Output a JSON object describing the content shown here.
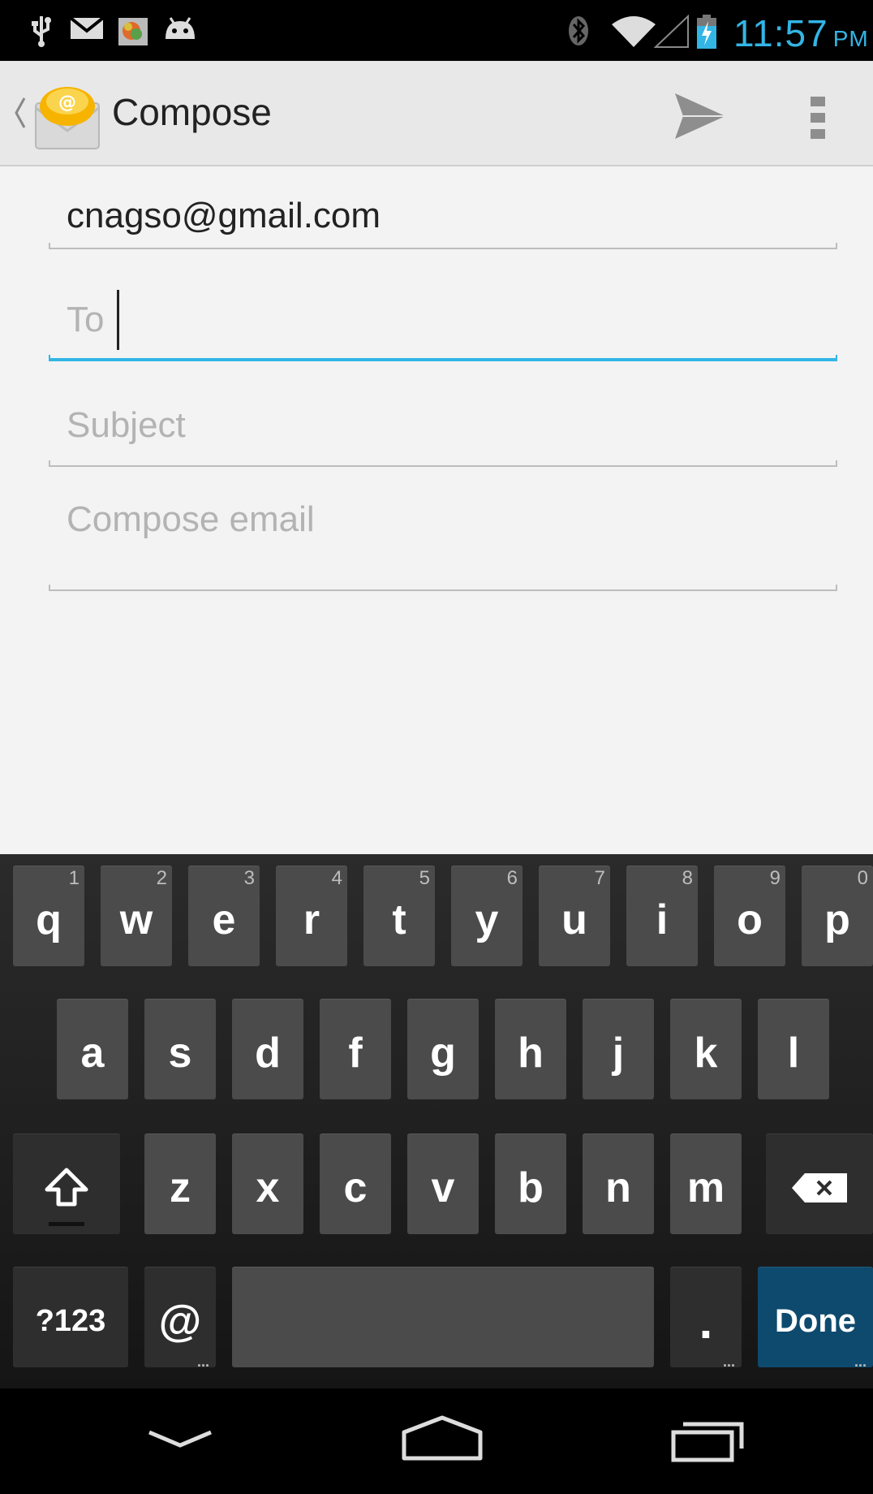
{
  "status_bar": {
    "icons": [
      "usb-icon",
      "gmail-icon",
      "photo-icon",
      "android-icon",
      "bluetooth-icon",
      "wifi-icon",
      "signal-icon",
      "battery-charging-icon"
    ],
    "time": "11:57",
    "ampm": "PM",
    "time_color": "#33b5e5"
  },
  "action_bar": {
    "title": "Compose",
    "icons": [
      "up-caret-icon",
      "email-app-icon",
      "send-icon",
      "overflow-menu-icon"
    ]
  },
  "compose": {
    "from_value": "cnagso@gmail.com",
    "to_placeholder": "To",
    "subject_placeholder": "Subject",
    "body_placeholder": "Compose email",
    "accent_color": "#33b5e5"
  },
  "keyboard": {
    "row1": [
      "q",
      "w",
      "e",
      "r",
      "t",
      "y",
      "u",
      "i",
      "o",
      "p"
    ],
    "row1_hints": [
      "1",
      "2",
      "3",
      "4",
      "5",
      "6",
      "7",
      "8",
      "9",
      "0"
    ],
    "row2": [
      "a",
      "s",
      "d",
      "f",
      "g",
      "h",
      "j",
      "k",
      "l"
    ],
    "row3": [
      "z",
      "x",
      "c",
      "v",
      "b",
      "n",
      "m"
    ],
    "symbols_label": "?123",
    "at_label": "@",
    "period_label": ".",
    "done_label": "Done",
    "icons": [
      "shift-icon",
      "backspace-icon"
    ]
  },
  "nav_bar": {
    "icons": [
      "back-icon",
      "home-icon",
      "recent-apps-icon"
    ]
  }
}
